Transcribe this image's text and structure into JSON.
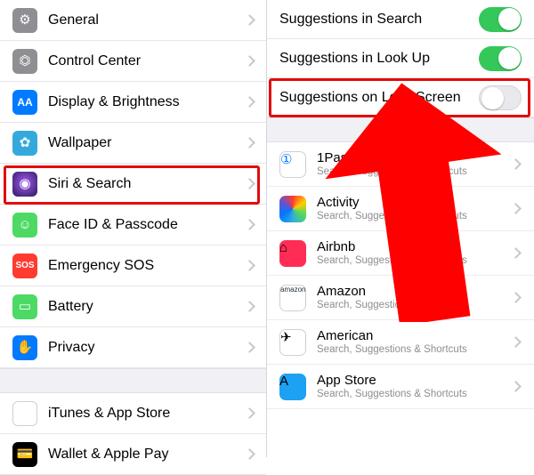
{
  "left": {
    "items": [
      {
        "label": "General",
        "icon": "gear-icon",
        "bg": "bg-gray"
      },
      {
        "label": "Control Center",
        "icon": "toggles-icon",
        "bg": "bg-gray"
      },
      {
        "label": "Display & Brightness",
        "icon": "aa-icon",
        "bg": "bg-blue"
      },
      {
        "label": "Wallpaper",
        "icon": "flower-icon",
        "bg": "bg-cyan"
      },
      {
        "label": "Siri & Search",
        "icon": "siri-icon",
        "bg": "bg-purple"
      },
      {
        "label": "Face ID & Passcode",
        "icon": "face-icon",
        "bg": "bg-green"
      },
      {
        "label": "Emergency SOS",
        "icon": "sos-icon",
        "bg": "bg-red"
      },
      {
        "label": "Battery",
        "icon": "battery-icon",
        "bg": "bg-green"
      },
      {
        "label": "Privacy",
        "icon": "hand-icon",
        "bg": "bg-blue"
      }
    ],
    "group2": [
      {
        "label": "iTunes & App Store",
        "icon": "appstore-icon",
        "bg": "bg-white"
      },
      {
        "label": "Wallet & Apple Pay",
        "icon": "wallet-icon",
        "bg": "bg-black"
      }
    ]
  },
  "right": {
    "toggles": [
      {
        "label": "Suggestions in Search",
        "on": true
      },
      {
        "label": "Suggestions in Look Up",
        "on": true
      },
      {
        "label": "Suggestions on Lock Screen",
        "on": false
      }
    ],
    "apps": [
      {
        "name": "1Password",
        "sub": "Search, Suggestions & Shortcuts",
        "icon": "1p-icon",
        "bg": "bg-white"
      },
      {
        "name": "Activity",
        "sub": "Search, Suggestions & Shortcuts",
        "icon": "activity-icon",
        "bg": "bg-multi"
      },
      {
        "name": "Airbnb",
        "sub": "Search, Suggestions & Shortcuts",
        "icon": "airbnb-icon",
        "bg": "bg-pink"
      },
      {
        "name": "Amazon",
        "sub": "Search, Suggestions & Shortcuts",
        "icon": "amazon-icon",
        "bg": "bg-amz"
      },
      {
        "name": "American",
        "sub": "Search, Suggestions & Shortcuts",
        "icon": "american-icon",
        "bg": "bg-am"
      },
      {
        "name": "App Store",
        "sub": "Search, Suggestions & Shortcuts",
        "icon": "appstore-icon",
        "bg": "bg-blue2"
      }
    ]
  },
  "glyphs": {
    "gear-icon": "⚙︎",
    "toggles-icon": "⏣",
    "aa-icon": "AA",
    "flower-icon": "✿",
    "siri-icon": "◉",
    "face-icon": "☺",
    "sos-icon": "SOS",
    "battery-icon": "▭",
    "hand-icon": "✋",
    "appstore-icon": "A",
    "wallet-icon": "💳",
    "1p-icon": "①",
    "activity-icon": "",
    "airbnb-icon": "⌂",
    "amazon-icon": "amazon",
    "american-icon": "✈"
  }
}
